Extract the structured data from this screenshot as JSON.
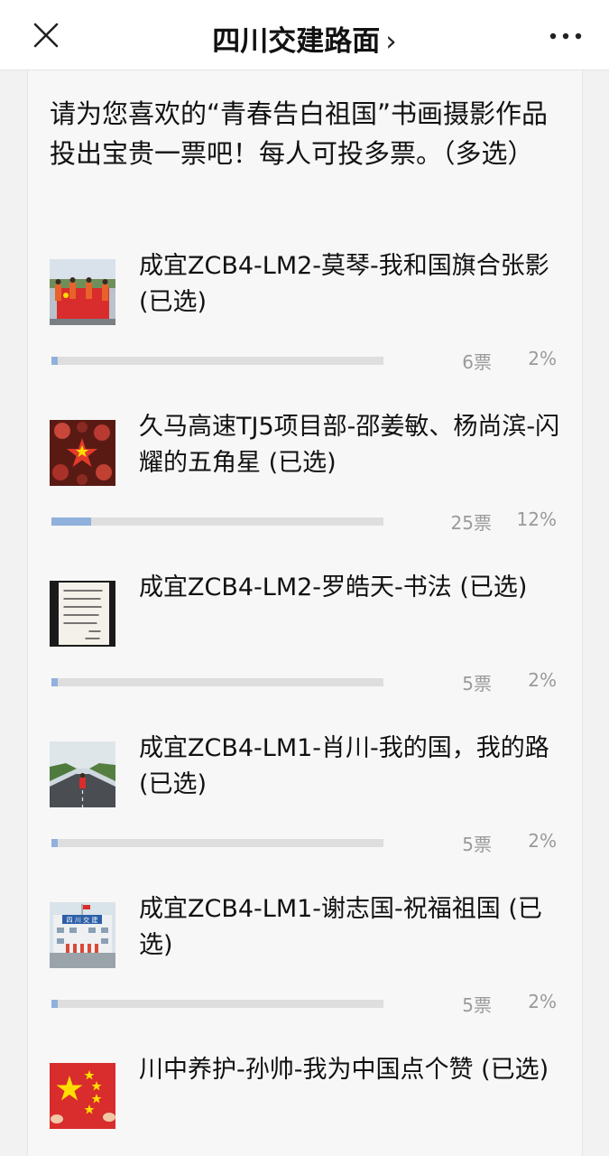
{
  "nav": {
    "title": "四川交建路面",
    "title_chevron": "›"
  },
  "question": "请为您喜欢的“青春告白祖国”书画摄影作品投出宝贵一票吧！每人可投多票。（多选）",
  "options": [
    {
      "title": "成宜ZCB4-LM2-莫琴-我和国旗合张影 (已选)",
      "votes": "6票",
      "percent": "2%",
      "fill": 0.02
    },
    {
      "title": "久马高速TJ5项目部-邵姜敏、杨尚滨-闪耀的五角星 (已选)",
      "votes": "25票",
      "percent": "12%",
      "fill": 0.12
    },
    {
      "title": "成宜ZCB4-LM2-罗皓天-书法 (已选)",
      "votes": "5票",
      "percent": "2%",
      "fill": 0.02
    },
    {
      "title": "成宜ZCB4-LM1-肖川-我的国，我的路 (已选)",
      "votes": "5票",
      "percent": "2%",
      "fill": 0.02
    },
    {
      "title": "成宜ZCB4-LM1-谢志国-祝福祖国 (已选)",
      "votes": "5票",
      "percent": "2%",
      "fill": 0.02
    },
    {
      "title": "川中养护-孙帅-我为中国点个赞 (已选)",
      "votes": "",
      "percent": "",
      "fill": 0
    }
  ],
  "thumbnails": {
    "building_sign_text": "四 川 交 建"
  },
  "colors": {
    "bar_fill": "#8fb1dc",
    "bar_track": "#dedede",
    "flag_red": "#d92c2c",
    "star_yellow": "#ffde00"
  }
}
